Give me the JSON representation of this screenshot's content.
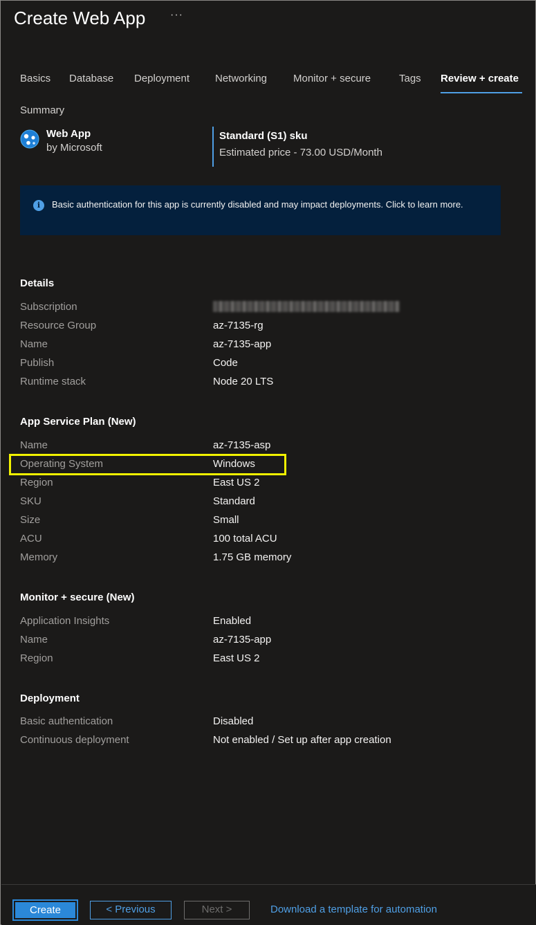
{
  "header": {
    "title": "Create Web App",
    "more": "···"
  },
  "tabs": [
    {
      "label": "Basics",
      "active": false
    },
    {
      "label": "Database",
      "active": false
    },
    {
      "label": "Deployment",
      "active": false
    },
    {
      "label": "Networking",
      "active": false
    },
    {
      "label": "Monitor + secure",
      "active": false
    },
    {
      "label": "Tags",
      "active": false
    },
    {
      "label": "Review + create",
      "active": true
    }
  ],
  "summary": {
    "label": "Summary",
    "app_name": "Web App",
    "publisher": "by Microsoft",
    "sku": "Standard (S1) sku",
    "price": "Estimated price - 73.00 USD/Month"
  },
  "banner": {
    "text": "Basic authentication for this app is currently disabled and may impact deployments. Click to learn more."
  },
  "details": {
    "title": "Details",
    "rows": [
      {
        "label": "Subscription",
        "value": ""
      },
      {
        "label": "Resource Group",
        "value": "az-7135-rg"
      },
      {
        "label": "Name",
        "value": "az-7135-app"
      },
      {
        "label": "Publish",
        "value": "Code"
      },
      {
        "label": "Runtime stack",
        "value": "Node 20 LTS"
      }
    ]
  },
  "plan": {
    "title": "App Service Plan (New)",
    "rows": [
      {
        "label": "Name",
        "value": "az-7135-asp"
      },
      {
        "label": "Operating System",
        "value": "Windows"
      },
      {
        "label": "Region",
        "value": "East US 2"
      },
      {
        "label": "SKU",
        "value": "Standard"
      },
      {
        "label": "Size",
        "value": "Small"
      },
      {
        "label": "ACU",
        "value": "100 total ACU"
      },
      {
        "label": "Memory",
        "value": "1.75 GB memory"
      }
    ]
  },
  "monitor": {
    "title": "Monitor + secure (New)",
    "rows": [
      {
        "label": "Application Insights",
        "value": "Enabled"
      },
      {
        "label": "Name",
        "value": "az-7135-app"
      },
      {
        "label": "Region",
        "value": "East US 2"
      }
    ]
  },
  "deployment": {
    "title": "Deployment",
    "rows": [
      {
        "label": "Basic authentication",
        "value": "Disabled"
      },
      {
        "label": "Continuous deployment",
        "value": "Not enabled / Set up after app creation"
      }
    ]
  },
  "footer": {
    "create": "Create",
    "previous": "< Previous",
    "next": "Next >",
    "template_link": "Download a template for automation"
  },
  "colors": {
    "accent": "#4f9fe5",
    "highlight": "#f2f200",
    "banner_bg": "#04203d"
  }
}
